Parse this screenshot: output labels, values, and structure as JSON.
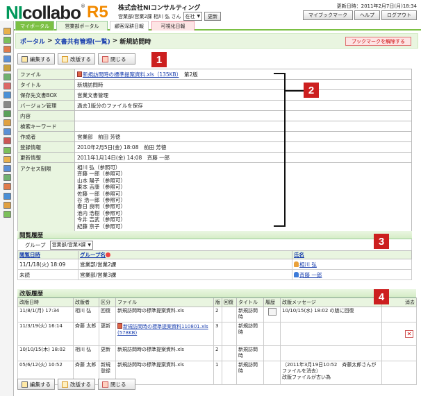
{
  "logo": {
    "ni": "NI",
    "collabo": "collabo",
    "reg": "®",
    "r5": "R5"
  },
  "header": {
    "company": "株式会社NIコンサルティング",
    "user_line": "営業部/営業2課 相川 弘 さん",
    "status_value": "在社",
    "update_button": "更新",
    "updated_at": "更新日時：2011年2月7日(月)18:34",
    "buttons": [
      "マイブックマーク",
      "ヘルプ",
      "ログアウト"
    ]
  },
  "tabs": [
    "マイポータル",
    "営業部ポータル",
    "顧客深耕日報",
    "可視化日報"
  ],
  "breadcrumb": {
    "items": [
      "ポータル",
      "文書共有管理(一覧)"
    ],
    "separator": ">",
    "current": "新規訪問時"
  },
  "bookmark_button": "ブックマークを解除する",
  "actions": {
    "edit": "編集する",
    "revise": "改版する",
    "close": "閉じる"
  },
  "markers": [
    "1",
    "2",
    "3",
    "4"
  ],
  "detail": {
    "file_label": "ファイル",
    "file_link": "新規訪問時の標準提案資料.xls（135KB）",
    "file_version": "第2版",
    "rows": [
      {
        "label": "タイトル",
        "value": "新規訪問時"
      },
      {
        "label": "保存先文書BOX",
        "value": "営業文書管理"
      },
      {
        "label": "バージョン管理",
        "value": "過去1版分のファイルを保存"
      },
      {
        "label": "内容",
        "value": ""
      },
      {
        "label": "検索キーワード",
        "value": ""
      },
      {
        "label": "作成者",
        "value": "営業部　前田 芳徳"
      },
      {
        "label": "登録情報",
        "value": "2010年2月5日(金) 18:08　前田 芳徳"
      },
      {
        "label": "更新情報",
        "value": "2011年1月14日(金) 14:08　斉藤 一郎"
      }
    ],
    "access_label": "アクセス制限",
    "access_list": [
      "相川 弘（参照可）",
      "斉藤 一郎（参照可）",
      "山本 陽子（参照可）",
      "東本 吉康（参照可）",
      "佐藤 一郎（参照可）",
      "谷 浩一郎（参照可）",
      "春日 良明（参照可）",
      "池内 浩樹（参照可）",
      "今井 吉武（参照可）",
      "紀藤 京子（参照可）"
    ]
  },
  "view_history": {
    "title": "閲覧履歴",
    "group_label": "グループ",
    "group_value": "営業部/営業3課",
    "headers": [
      "閲覧日時",
      "グループ名",
      "氏名"
    ],
    "rows": [
      {
        "date": "11/1/18(火) 18:09",
        "group": "営業部/営業2課",
        "name": "相川 弘",
        "icon": "orange"
      },
      {
        "date": "未読",
        "group": "営業部/営業3課",
        "name": "斉藤 一郎",
        "icon": "blue"
      }
    ]
  },
  "revision_history": {
    "title": "改版履歴",
    "headers": [
      "改版日時",
      "改版者",
      "区分",
      "ファイル",
      "版",
      "回復",
      "タイトル",
      "履歴",
      "改版メッセージ",
      "消去"
    ],
    "rows": [
      {
        "date": "11/8/1(月) 17:34",
        "user": "相川 弘",
        "kind": "回復",
        "file": "新規訪問時の標準提案資料.xls",
        "file_link": false,
        "file_size": "",
        "ver": "2",
        "restore": "",
        "title": "新規訪問時",
        "memo": true,
        "message": "10/10/15(水) 18:02 の版に回復",
        "del": false
      },
      {
        "date": "11/3/19(火) 16:14",
        "user": "斉藤 太郎",
        "kind": "更新",
        "file": "新規訪問時の標準提案資料110801.xls",
        "file_link": true,
        "file_size": "(578KB)",
        "ver": "3",
        "restore": "",
        "title": "新規訪問時",
        "memo": false,
        "message": "",
        "del": true
      },
      {
        "date": "10/10/15(木) 18:02",
        "user": "相川 弘",
        "kind": "更新",
        "file": "新規訪問時の標準提案資料.xls",
        "file_link": false,
        "file_size": "",
        "ver": "2",
        "restore": "",
        "title": "新規訪問時",
        "memo": false,
        "message": "",
        "del": false
      },
      {
        "date": "05/6/12(火) 10:52",
        "user": "斉藤 太郎",
        "kind": "新規登録",
        "file": "新規訪問時の標準提案資料.xls",
        "file_link": false,
        "file_size": "",
        "ver": "1",
        "restore": "",
        "title": "新規訪問時",
        "memo": false,
        "message": "（2011年3月19日10:52　斉藤太郎さんがファイルを消去）\n改版ファイルが古い為",
        "del": false
      }
    ]
  }
}
